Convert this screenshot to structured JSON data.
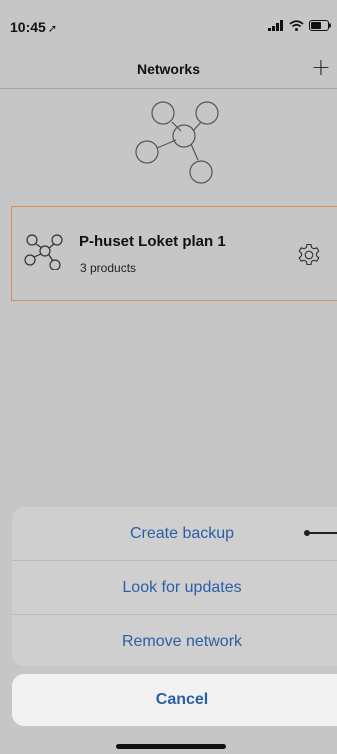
{
  "status_bar": {
    "time": "10:45",
    "icons": [
      "signal-icon",
      "wifi-icon",
      "battery-icon"
    ]
  },
  "nav": {
    "title": "Networks",
    "add_icon": "plus-icon"
  },
  "network": {
    "name": "P-huset Loket plan 1",
    "subtitle": "3 products",
    "accent_color": "#d98e55",
    "icon": "network-icon",
    "settings_icon": "gear-icon"
  },
  "action_sheet": {
    "items": [
      "Create backup",
      "Look for updates",
      "Remove network"
    ],
    "cancel_label": "Cancel",
    "text_color": "#2a5fa8"
  }
}
